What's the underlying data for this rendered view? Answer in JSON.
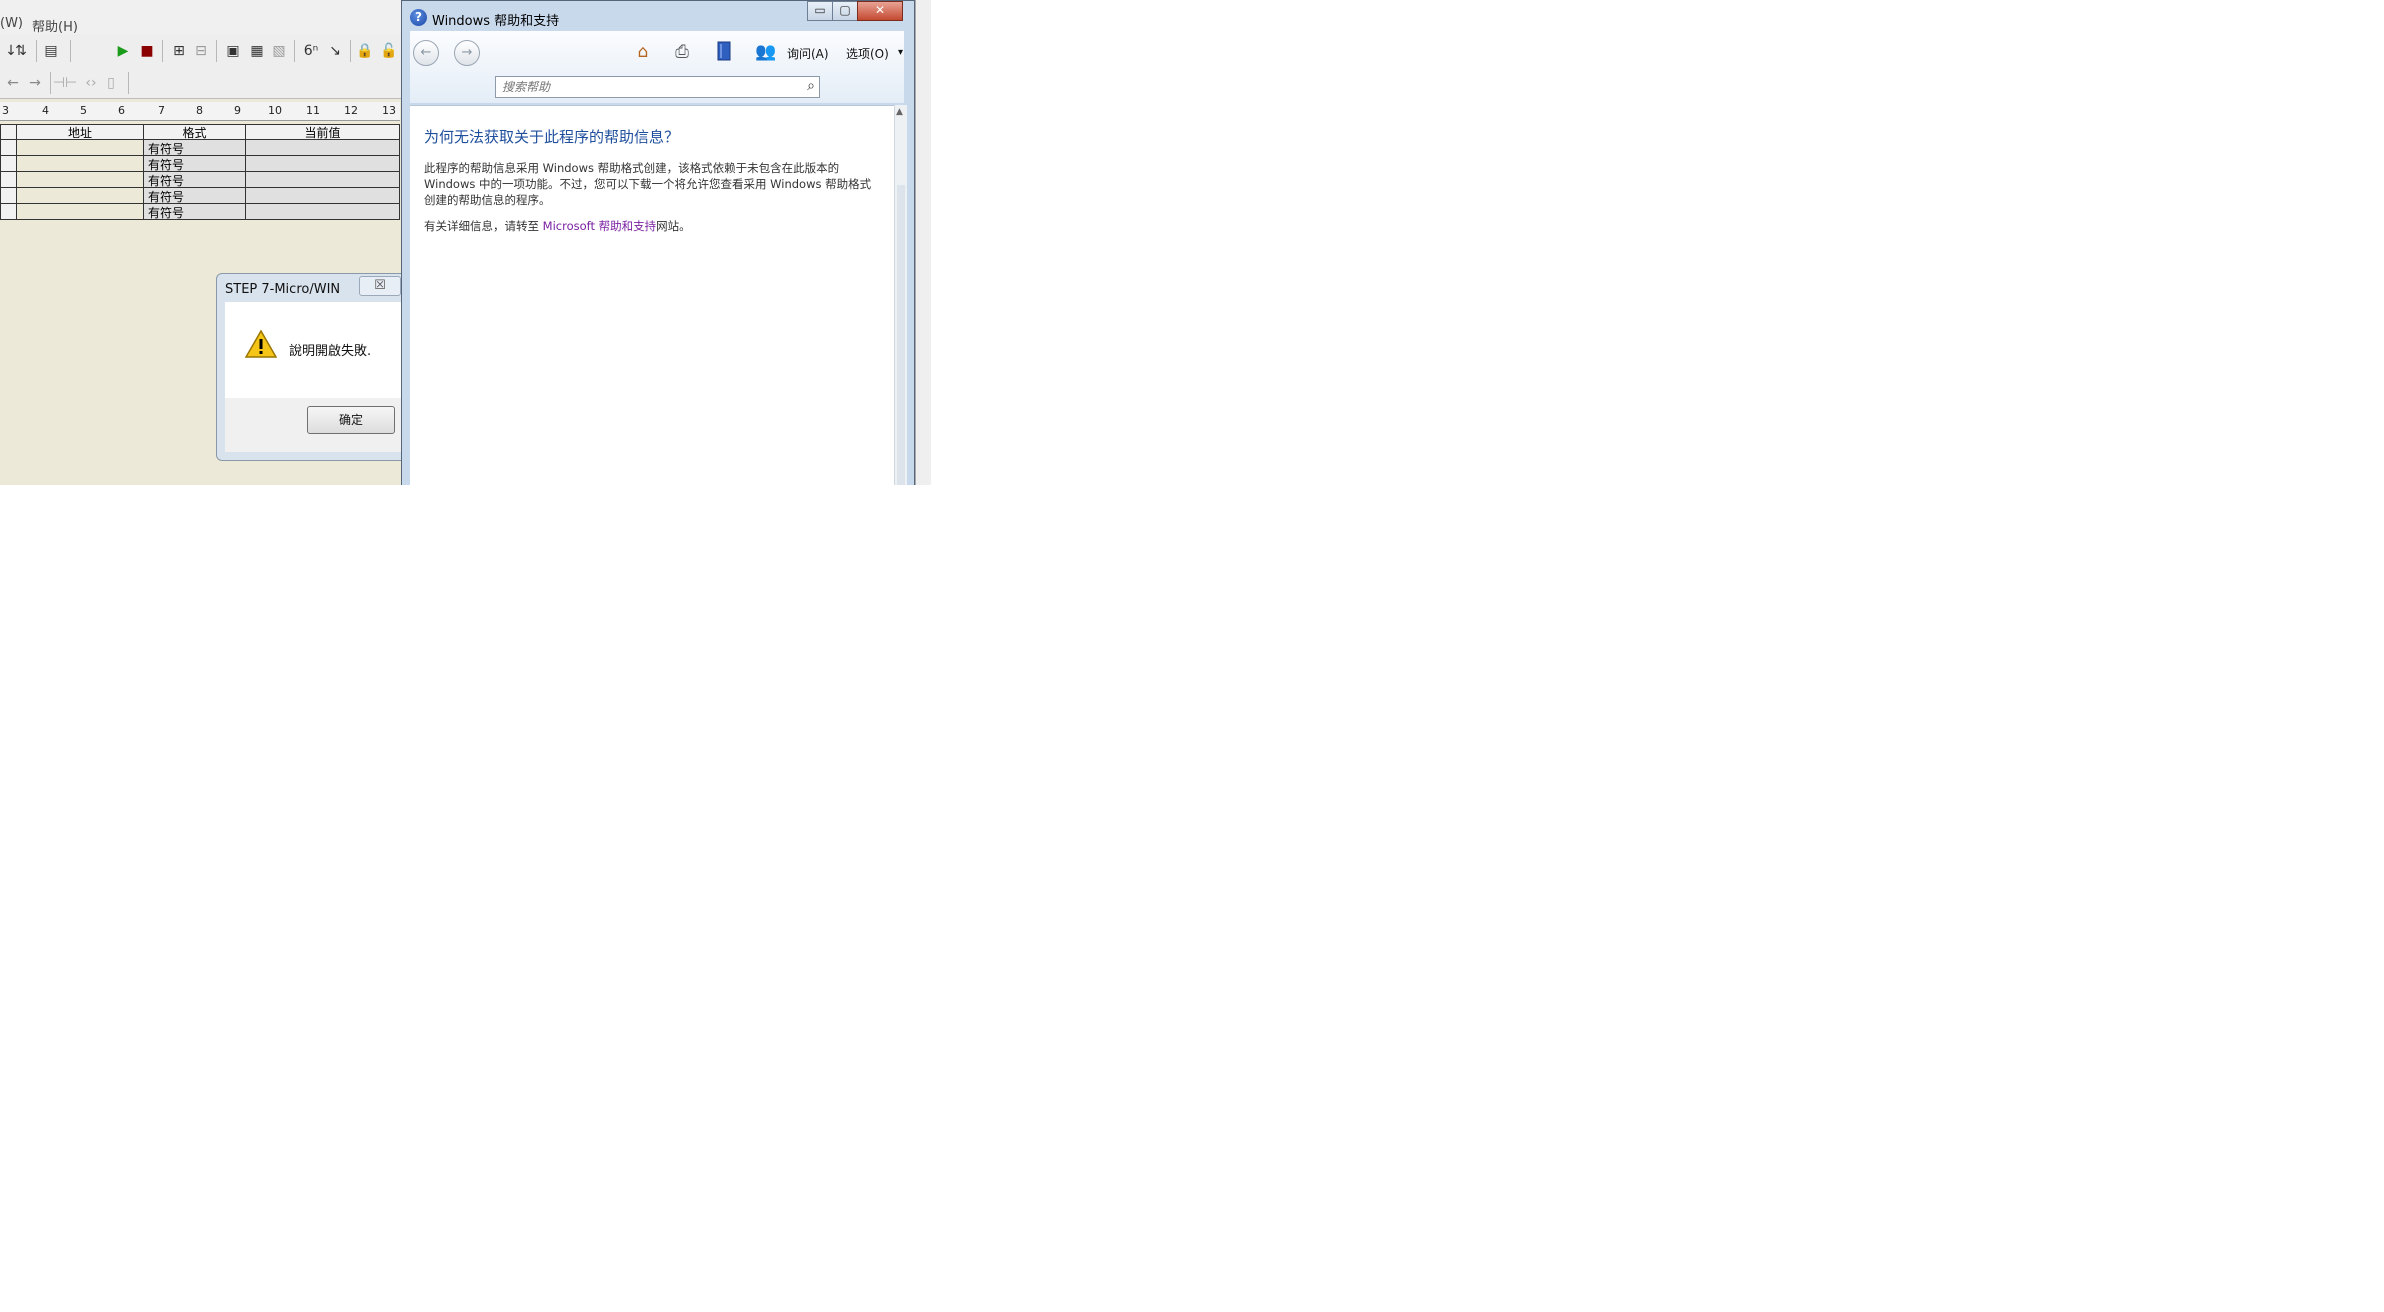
{
  "app": {
    "menu": [
      "(W)",
      "帮助(H)"
    ],
    "ruler_ticks": [
      "3",
      "4",
      "5",
      "6",
      "7",
      "8",
      "9",
      "10",
      "11",
      "12",
      "13"
    ],
    "table": {
      "headers": [
        "地址",
        "格式",
        "当前值"
      ],
      "rows": [
        {
          "address": "",
          "format": "有符号",
          "value": ""
        },
        {
          "address": "",
          "format": "有符号",
          "value": ""
        },
        {
          "address": "",
          "format": "有符号",
          "value": ""
        },
        {
          "address": "",
          "format": "有符号",
          "value": ""
        },
        {
          "address": "",
          "format": "有符号",
          "value": ""
        }
      ]
    }
  },
  "msgbox": {
    "title": "STEP 7-Micro/WIN",
    "close_glyph": "☒",
    "icon": "warning-icon",
    "message": "說明開啟失敗.",
    "ok_label": "确定"
  },
  "help": {
    "title": "Windows 帮助和支持",
    "caption": {
      "minimize": "▭",
      "maximize": "▢",
      "close": "✕"
    },
    "toolbar": {
      "ask_label": "询问(A)",
      "options_label": "选项(O)",
      "options_arrow": "▾"
    },
    "search": {
      "placeholder": "搜索帮助"
    },
    "article": {
      "heading": "为何无法获取关于此程序的帮助信息？",
      "p1": "此程序的帮助信息采用 Windows 帮助格式创建，该格式依赖于未包含在此版本的 Windows 中的一项功能。不过，您可以下载一个将允许您查看采用 Windows 帮助格式创建的帮助信息的程序。",
      "p2_prefix": "有关详细信息，请转至 ",
      "p2_link": "Microsoft 帮助和支持",
      "p2_suffix": "网站。"
    }
  },
  "colors": {
    "heading": "#1e4e9c",
    "link": "#7a1fa2",
    "close_button": "#c44a30"
  }
}
